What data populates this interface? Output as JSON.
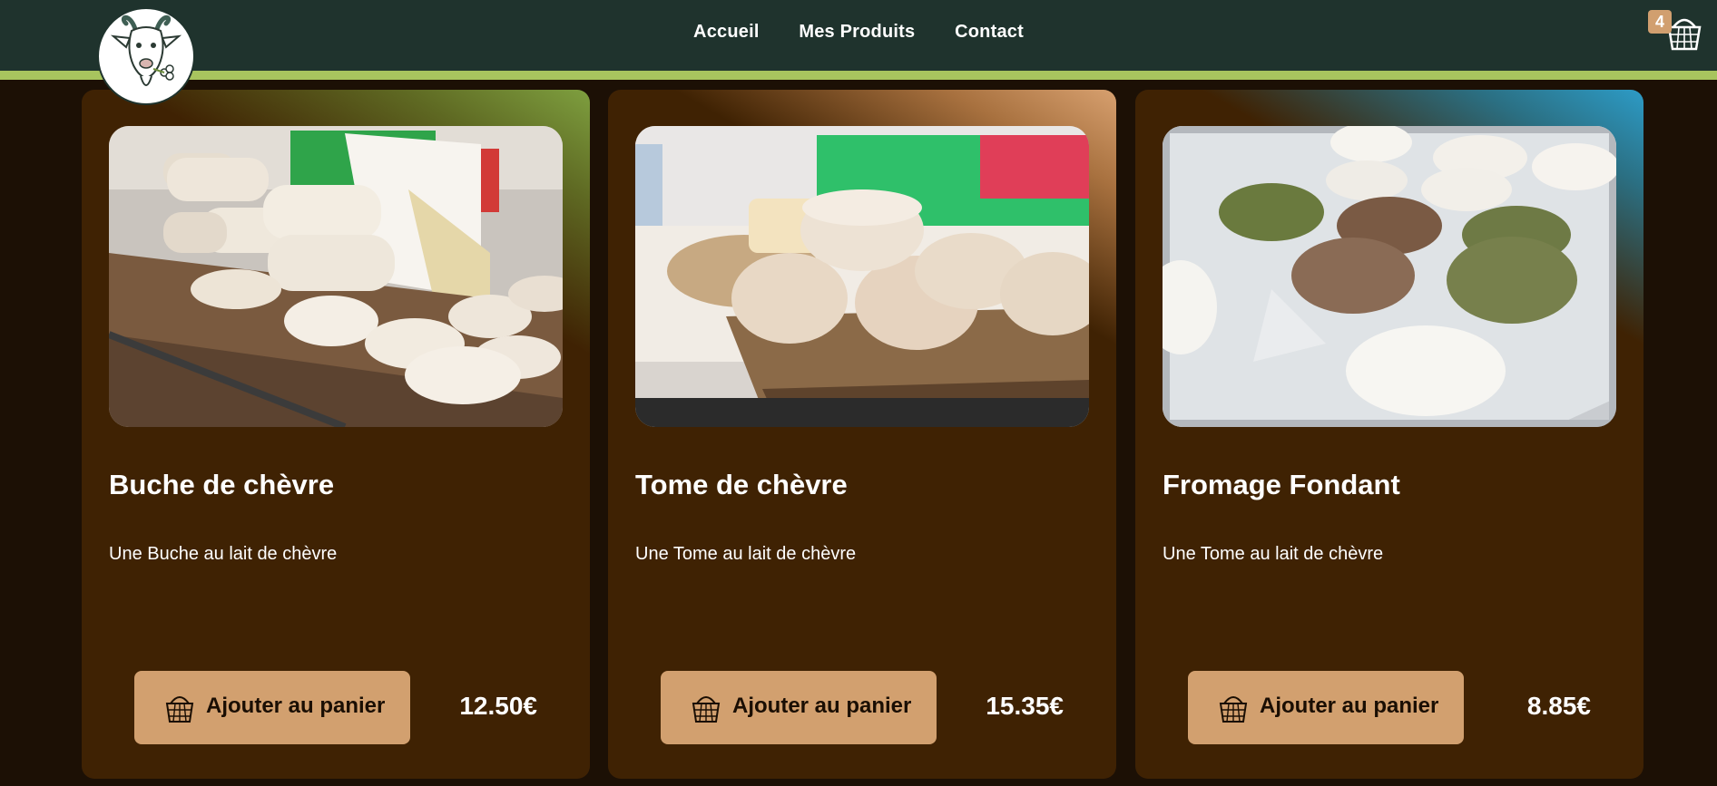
{
  "nav": {
    "items": [
      "Accueil",
      "Mes Produits",
      "Contact"
    ]
  },
  "cart": {
    "count": "4",
    "icon": "basket-icon"
  },
  "colors": {
    "header": "#1f332d",
    "stripe": "#a8c45e",
    "card": "#3f2203",
    "button": "#d2a06f",
    "accent_green": "#7e9f3f",
    "accent_tan": "#d7a06f",
    "accent_blue": "#2d9bc6"
  },
  "products": [
    {
      "name": "Buche de chèvre",
      "description": "Une Buche au lait de chèvre",
      "button": "Ajouter au panier",
      "price": "12.50€"
    },
    {
      "name": "Tome de chèvre",
      "description": "Une Tome au lait de chèvre",
      "button": "Ajouter au panier",
      "price": "15.35€"
    },
    {
      "name": "Fromage Fondant",
      "description": "Une Tome au lait de chèvre",
      "button": "Ajouter au panier",
      "price": "8.85€"
    }
  ]
}
